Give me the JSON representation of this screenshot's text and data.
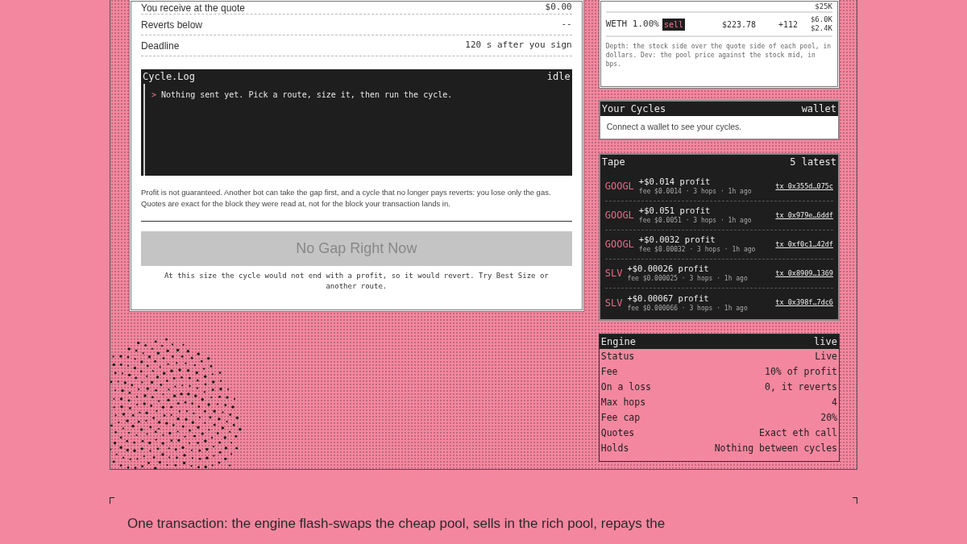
{
  "quote_rows": [
    {
      "label": "You receive at the quote",
      "value": "$0.00"
    },
    {
      "label": "Reverts below",
      "value": "--"
    },
    {
      "label": "Deadline",
      "value": "120 s after you sign"
    }
  ],
  "cycle_log": {
    "title": "Cycle.Log",
    "status": "idle",
    "lines": [
      {
        "prompt": ">",
        "text": "Nothing sent yet. Pick a route, size it, then run the cycle."
      }
    ]
  },
  "note": "Profit is not guaranteed. Another bot can take the gap first, and a cycle that no longer pays reverts: you lose only the gas. Quotes are exact for the block they were read at, not for the block your transaction lands in.",
  "action_button": {
    "label": "No Gap Right Now",
    "disabled": true
  },
  "action_hint": "At this size the cycle would not end with a profit, so it would revert. Try Best Size or another route.",
  "pools": {
    "partial_depth": "$25K",
    "rows": [
      {
        "pool": "WETH 1.00%",
        "side": "sell",
        "price": "$223.78",
        "dev": "+112",
        "depth": [
          "$6.0K",
          "$2.4K"
        ]
      }
    ],
    "footnote": "Depth: the stock side over the quote side of each pool, in dollars. Dev: the pool price against the stock mid, in bps."
  },
  "your_cycles": {
    "title": "Your Cycles",
    "tag": "wallet",
    "message": "Connect a wallet to see your cycles."
  },
  "tape": {
    "title": "Tape",
    "tag": "5 latest",
    "items": [
      {
        "symbol": "GOOGL",
        "profit": "+$0.014 profit",
        "detail": "fee $0.0014 · 3 hops · 1h ago",
        "tx": "tx 0x355d…075c"
      },
      {
        "symbol": "GOOGL",
        "profit": "+$0.051 profit",
        "detail": "fee $0.0051 · 3 hops · 1h ago",
        "tx": "tx 0x979e…6ddf"
      },
      {
        "symbol": "GOOGL",
        "profit": "+$0.0032 profit",
        "detail": "fee $0.00032 · 3 hops · 1h ago",
        "tx": "tx 0xf0c1…42df"
      },
      {
        "symbol": "SLV",
        "profit": "+$0.00026 profit",
        "detail": "fee $0.000025 · 3 hops · 1h ago",
        "tx": "tx 0x8909…1369"
      },
      {
        "symbol": "SLV",
        "profit": "+$0.00067 profit",
        "detail": "fee $0.000066 · 3 hops · 1h ago",
        "tx": "tx 0x398f…7dc6"
      }
    ]
  },
  "engine": {
    "title": "Engine",
    "status": "live",
    "rows": [
      {
        "label": "Status",
        "value": "Live"
      },
      {
        "label": "Fee",
        "value": "10% of profit"
      },
      {
        "label": "On a loss",
        "value": "0, it reverts"
      },
      {
        "label": "Max hops",
        "value": "4"
      },
      {
        "label": "Fee cap",
        "value": "20%"
      },
      {
        "label": "Quotes",
        "value": "Exact eth call"
      },
      {
        "label": "Holds",
        "value": "Nothing between cycles"
      }
    ]
  },
  "footer_paragraph": "One transaction: the engine flash-swaps the cheap pool, sells in the rich pool, repays the"
}
